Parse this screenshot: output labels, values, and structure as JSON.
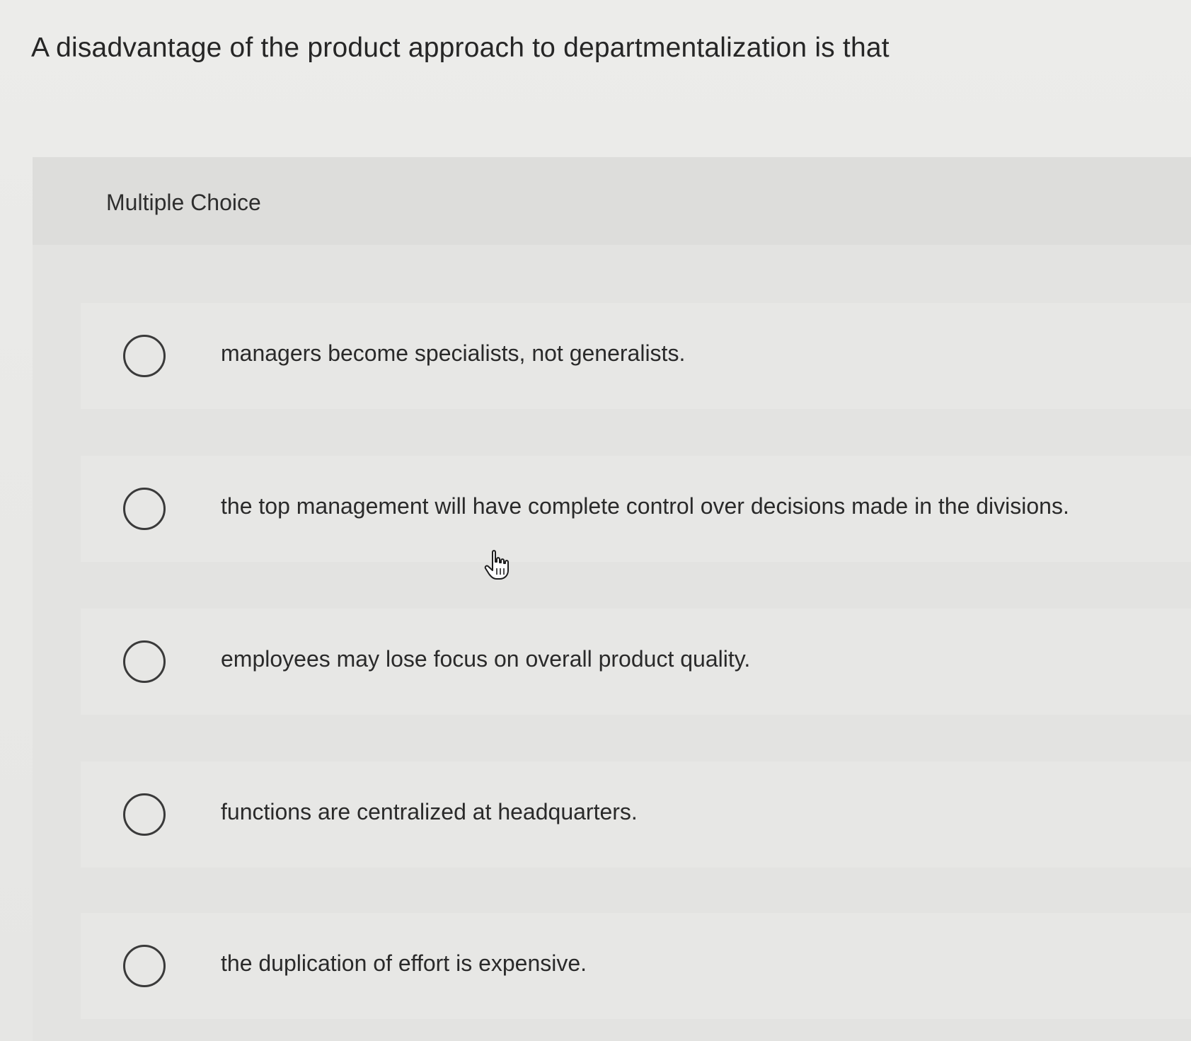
{
  "question": {
    "text": "A disadvantage of the product approach to departmentalization is that"
  },
  "panel": {
    "label": "Multiple Choice"
  },
  "options": [
    {
      "label": "managers become specialists, not generalists.",
      "selected": false
    },
    {
      "label": "the top management will have complete control over decisions made in the divisions.",
      "selected": false
    },
    {
      "label": "employees may lose focus on overall product quality.",
      "selected": false
    },
    {
      "label": "functions are centralized at headquarters.",
      "selected": false
    },
    {
      "label": "the duplication of effort is expensive.",
      "selected": false
    }
  ],
  "icons": {
    "radio": "radio-unchecked-icon",
    "cursor": "hand-pointer-icon"
  }
}
